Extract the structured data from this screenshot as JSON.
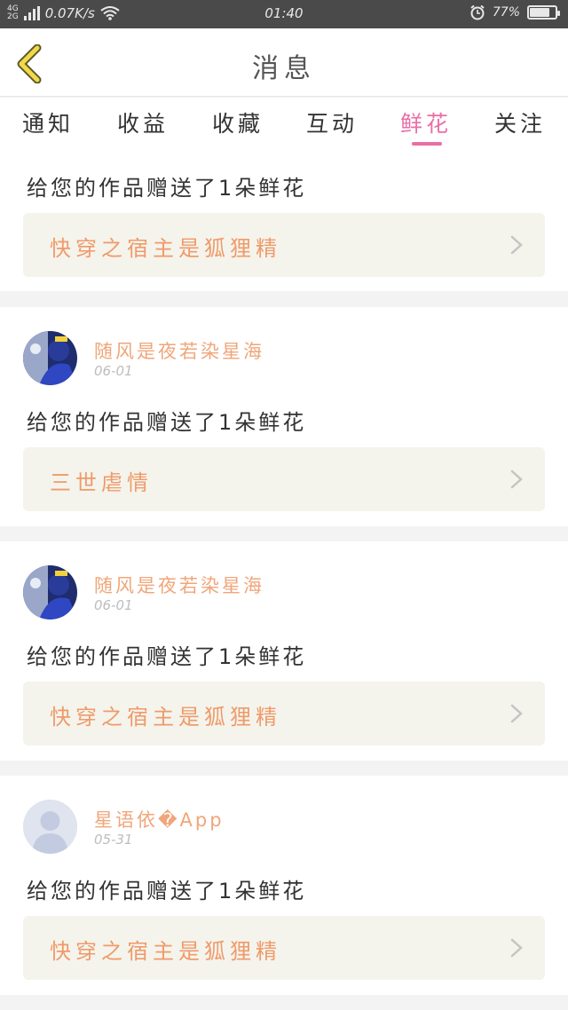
{
  "status_bar": {
    "network_top": "4G",
    "network_bottom": "2G",
    "speed": "0.07K/s",
    "time": "01:40",
    "battery": "77%",
    "battery_level": 0.77,
    "icons": [
      "signal-icon",
      "wifi-icon",
      "alarm-icon",
      "battery-icon"
    ]
  },
  "header": {
    "title": "消息",
    "back_icon": "chevron-left-icon"
  },
  "tabs": [
    {
      "label": "通知"
    },
    {
      "label": "收益"
    },
    {
      "label": "收藏"
    },
    {
      "label": "互动"
    },
    {
      "label": "鲜花"
    },
    {
      "label": "关注"
    }
  ],
  "active_tab": "鲜花",
  "messages": [
    {
      "message": "给您的作品赠送了1朵鲜花",
      "work_title": "快穿之宿主是狐狸精"
    },
    {
      "username": "随风是夜若染星海",
      "date": "06-01",
      "message": "给您的作品赠送了1朵鲜花",
      "work_title": "三世虐情"
    },
    {
      "username": "随风是夜若染星海",
      "date": "06-01",
      "message": "给您的作品赠送了1朵鲜花",
      "work_title": "快穿之宿主是狐狸精"
    },
    {
      "username": "星语依�App",
      "date": "05-31",
      "message": "给您的作品赠送了1朵鲜花",
      "work_title": "快穿之宿主是狐狸精"
    }
  ],
  "colors": {
    "accent_pink": "#e96fa7",
    "username_orange": "#f0a67a",
    "work_title_orange": "#f09a6a",
    "back_chevron_yellow": "#f5d84a"
  }
}
